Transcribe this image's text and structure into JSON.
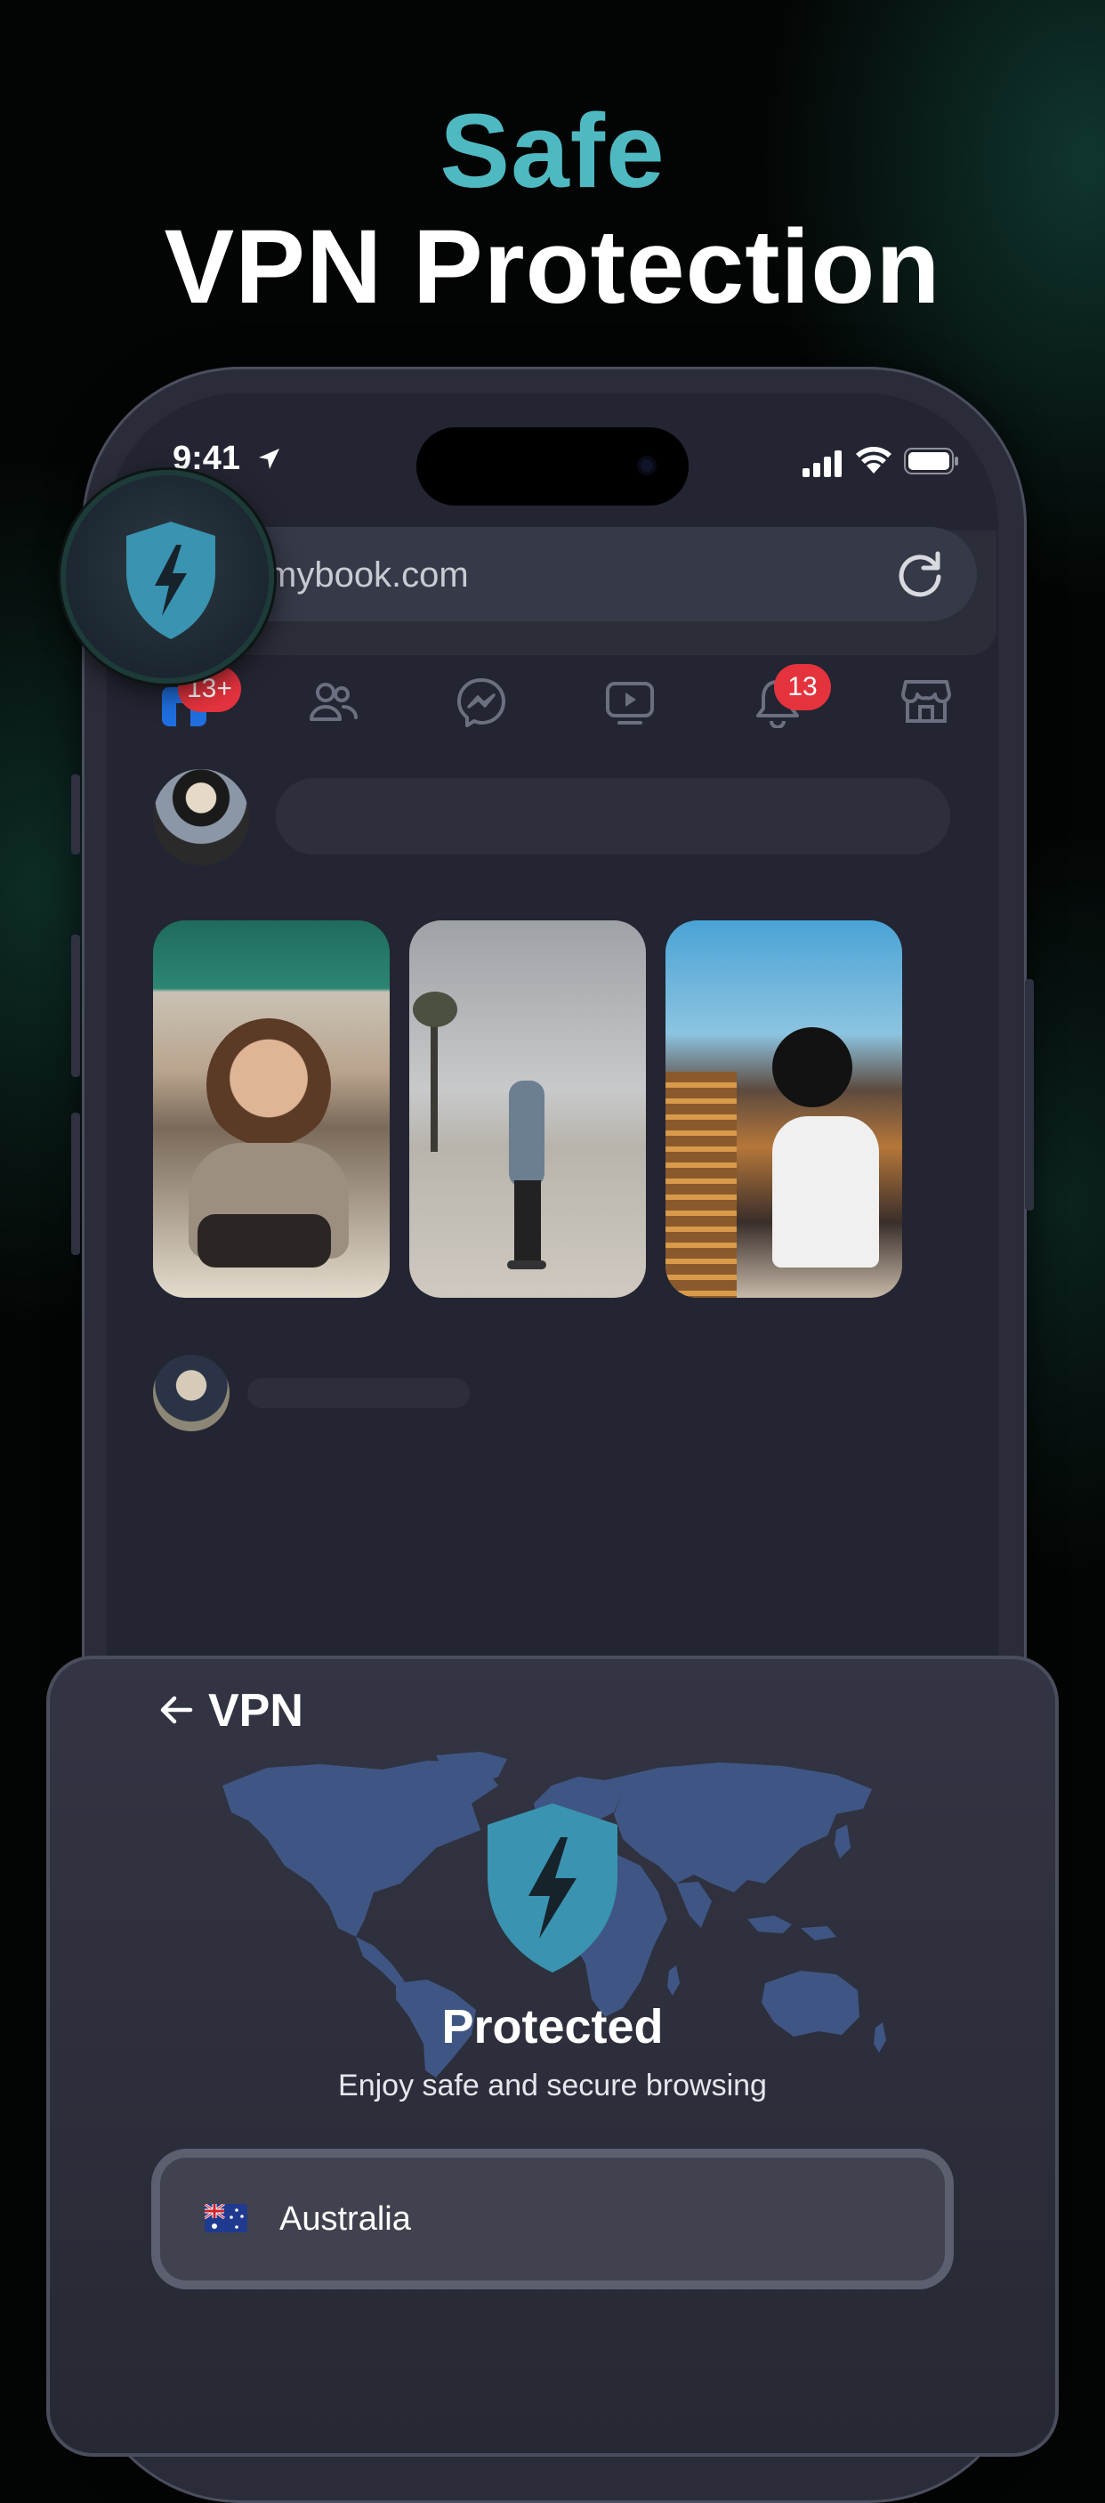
{
  "headline": {
    "accent": "Safe",
    "title": "VPN Protection"
  },
  "status_bar": {
    "time": "9:41"
  },
  "browser": {
    "url": "mybook.com"
  },
  "nav": {
    "home_badge": "13+",
    "notifications_badge": "13"
  },
  "vpn": {
    "title": "VPN",
    "status": "Protected",
    "subtitle": "Enjoy safe and secure browsing",
    "country": "Australia"
  },
  "colors": {
    "accent": "#4fb9c2",
    "shield": "#3a93b0",
    "badge": "#e5333e",
    "map": "#3f5684"
  }
}
